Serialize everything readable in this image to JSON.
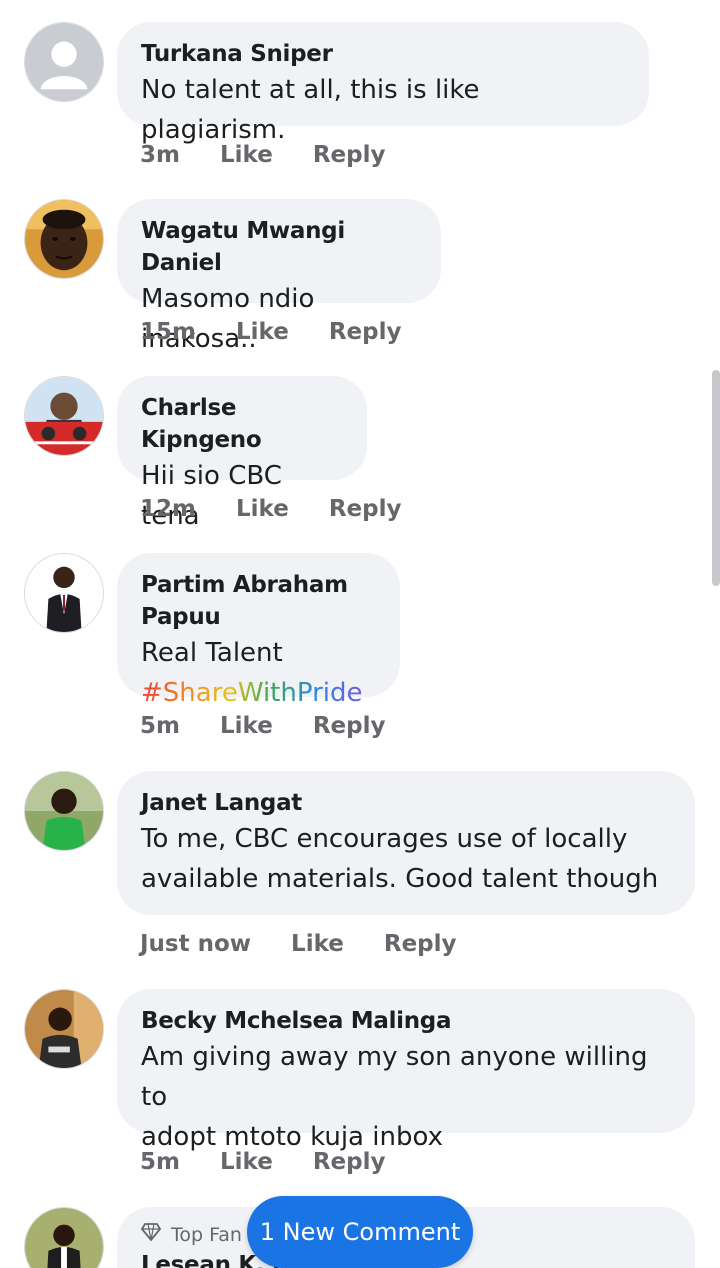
{
  "comments": [
    {
      "author": "Turkana Sniper",
      "text": "No talent  at all,  this is like plagiarism.",
      "time": "3m",
      "like": "Like",
      "reply": "Reply"
    },
    {
      "author": "Wagatu Mwangi Daniel",
      "text": "Masomo ndio inakosa..",
      "time": "15m",
      "like": "Like",
      "reply": "Reply"
    },
    {
      "author": "Charlse Kipngeno",
      "text": "Hii sio CBC tena",
      "time": "12m",
      "like": "Like",
      "reply": "Reply"
    },
    {
      "author": "Partim Abraham Papuu",
      "text": "Real Talent",
      "hashtag": "#ShareWithPride",
      "time": "5m",
      "like": "Like",
      "reply": "Reply"
    },
    {
      "author": "Janet Langat",
      "text_line1": "To me, CBC encourages use of locally",
      "text_line2": "available materials. Good talent though",
      "time": "Just now",
      "like": "Like",
      "reply": "Reply"
    },
    {
      "author": "Becky Mchelsea Malinga",
      "text_line1": "Am giving away my son anyone willing to",
      "text_line2": "adopt mtoto kuja inbox",
      "time": "5m",
      "like": "Like",
      "reply": "Reply"
    },
    {
      "badge": "Top Fan",
      "author": "Lesean K. Je..."
    }
  ],
  "new_comment_button": "1 New Comment",
  "icons": [
    "default-avatar-icon",
    "diamond-icon"
  ],
  "colors": {
    "bubble": "#f0f2f5",
    "action_text": "#65676b",
    "primary_button": "#1b74e4"
  }
}
